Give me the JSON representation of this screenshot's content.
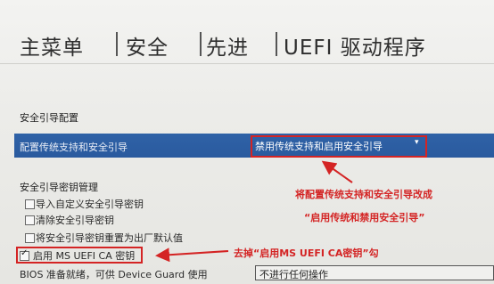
{
  "tabs": [
    "主菜单",
    "安全",
    "先进",
    "UEFI 驱动程序"
  ],
  "secure_boot_config": {
    "title": "安全引导配置",
    "row_label": "配置传统支持和安全引导",
    "row_value": "禁用传统支持和启用安全引导",
    "dropdown_arrow_icon": "chevron-down-icon"
  },
  "key_management": {
    "title": "安全引导密钥管理",
    "items": [
      {
        "label": "导入自定义安全引导密钥",
        "checked": false
      },
      {
        "label": "清除安全引导密钥",
        "checked": false
      },
      {
        "label": "将安全引导密钥重置为出厂默认值",
        "checked": false
      },
      {
        "label": "启用 MS UEFI CA 密钥",
        "checked": true
      }
    ]
  },
  "bios_row": {
    "label": "BIOS 准备就绪，可供 Device Guard 使用",
    "value": "不进行任何操作"
  },
  "annotations": {
    "note1_line1": "将配置传统支持和安全引导改成",
    "note1_line2": "“启用传统和禁用安全引导”",
    "note2": "去掉“启用MS UEFI CA密钥”勾"
  },
  "colors": {
    "accent": "#2f62a7",
    "annotation": "#d42424"
  }
}
